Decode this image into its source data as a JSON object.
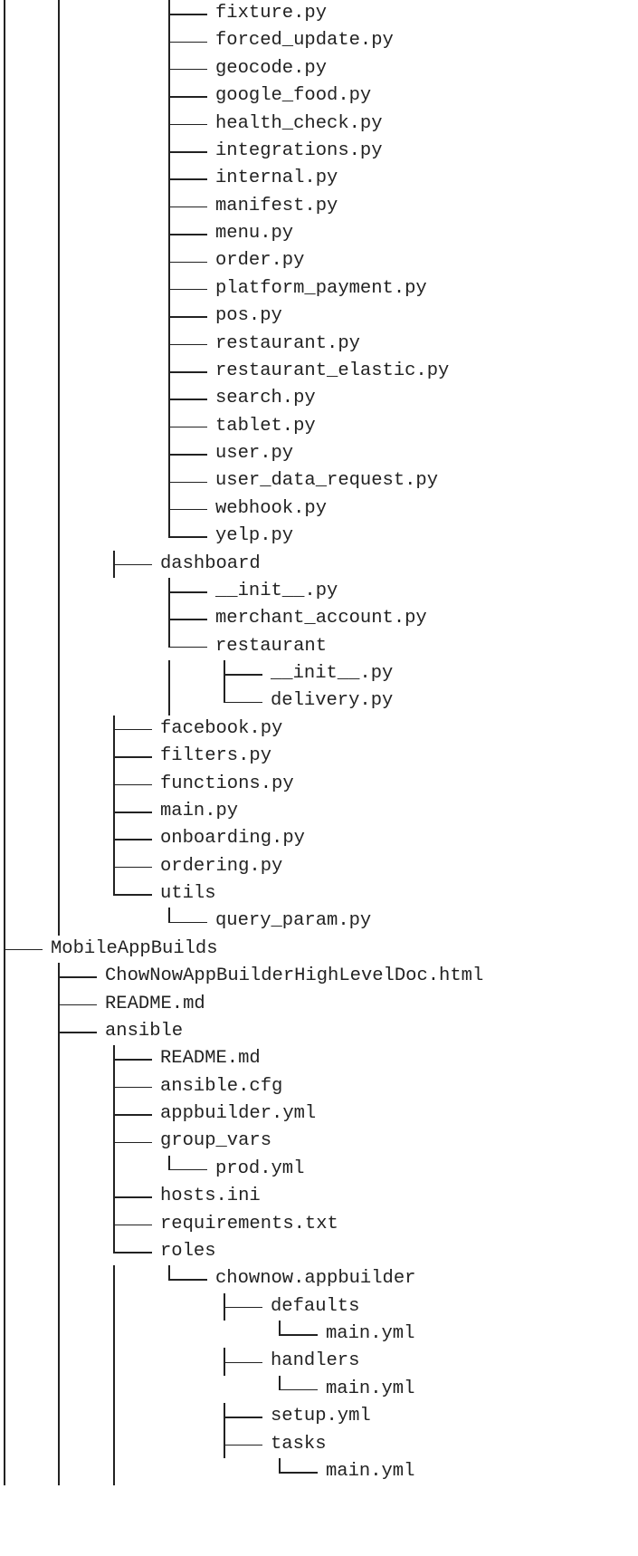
{
  "tree": [
    {
      "name": "fixture.py",
      "depth": 3,
      "ancestors_continue": [
        true,
        true,
        false,
        true
      ],
      "last": false
    },
    {
      "name": "forced_update.py",
      "depth": 3,
      "ancestors_continue": [
        true,
        true,
        false,
        true
      ],
      "last": false
    },
    {
      "name": "geocode.py",
      "depth": 3,
      "ancestors_continue": [
        true,
        true,
        false,
        true
      ],
      "last": false
    },
    {
      "name": "google_food.py",
      "depth": 3,
      "ancestors_continue": [
        true,
        true,
        false,
        true
      ],
      "last": false
    },
    {
      "name": "health_check.py",
      "depth": 3,
      "ancestors_continue": [
        true,
        true,
        false,
        true
      ],
      "last": false
    },
    {
      "name": "integrations.py",
      "depth": 3,
      "ancestors_continue": [
        true,
        true,
        false,
        true
      ],
      "last": false
    },
    {
      "name": "internal.py",
      "depth": 3,
      "ancestors_continue": [
        true,
        true,
        false,
        true
      ],
      "last": false
    },
    {
      "name": "manifest.py",
      "depth": 3,
      "ancestors_continue": [
        true,
        true,
        false,
        true
      ],
      "last": false
    },
    {
      "name": "menu.py",
      "depth": 3,
      "ancestors_continue": [
        true,
        true,
        false,
        true
      ],
      "last": false
    },
    {
      "name": "order.py",
      "depth": 3,
      "ancestors_continue": [
        true,
        true,
        false,
        true
      ],
      "last": false
    },
    {
      "name": "platform_payment.py",
      "depth": 3,
      "ancestors_continue": [
        true,
        true,
        false,
        true
      ],
      "last": false
    },
    {
      "name": "pos.py",
      "depth": 3,
      "ancestors_continue": [
        true,
        true,
        false,
        true
      ],
      "last": false
    },
    {
      "name": "restaurant.py",
      "depth": 3,
      "ancestors_continue": [
        true,
        true,
        false,
        true
      ],
      "last": false
    },
    {
      "name": "restaurant_elastic.py",
      "depth": 3,
      "ancestors_continue": [
        true,
        true,
        false,
        true
      ],
      "last": false
    },
    {
      "name": "search.py",
      "depth": 3,
      "ancestors_continue": [
        true,
        true,
        false,
        true
      ],
      "last": false
    },
    {
      "name": "tablet.py",
      "depth": 3,
      "ancestors_continue": [
        true,
        true,
        false,
        true
      ],
      "last": false
    },
    {
      "name": "user.py",
      "depth": 3,
      "ancestors_continue": [
        true,
        true,
        false,
        true
      ],
      "last": false
    },
    {
      "name": "user_data_request.py",
      "depth": 3,
      "ancestors_continue": [
        true,
        true,
        false,
        true
      ],
      "last": false
    },
    {
      "name": "webhook.py",
      "depth": 3,
      "ancestors_continue": [
        true,
        true,
        false,
        true
      ],
      "last": false
    },
    {
      "name": "yelp.py",
      "depth": 3,
      "ancestors_continue": [
        true,
        true,
        false,
        true
      ],
      "last": true
    },
    {
      "name": "dashboard",
      "depth": 2,
      "ancestors_continue": [
        true,
        true,
        false
      ],
      "last": false
    },
    {
      "name": "__init__.py",
      "depth": 3,
      "ancestors_continue": [
        true,
        true,
        false,
        true
      ],
      "last": false
    },
    {
      "name": "merchant_account.py",
      "depth": 3,
      "ancestors_continue": [
        true,
        true,
        false,
        true
      ],
      "last": false
    },
    {
      "name": "restaurant",
      "depth": 3,
      "ancestors_continue": [
        true,
        true,
        false,
        true
      ],
      "last": true
    },
    {
      "name": "__init__.py",
      "depth": 4,
      "ancestors_continue": [
        true,
        true,
        false,
        true,
        false
      ],
      "last": false
    },
    {
      "name": "delivery.py",
      "depth": 4,
      "ancestors_continue": [
        true,
        true,
        false,
        true,
        false
      ],
      "last": true
    },
    {
      "name": "facebook.py",
      "depth": 2,
      "ancestors_continue": [
        true,
        true,
        false
      ],
      "last": false
    },
    {
      "name": "filters.py",
      "depth": 2,
      "ancestors_continue": [
        true,
        true,
        false
      ],
      "last": false
    },
    {
      "name": "functions.py",
      "depth": 2,
      "ancestors_continue": [
        true,
        true,
        false
      ],
      "last": false
    },
    {
      "name": "main.py",
      "depth": 2,
      "ancestors_continue": [
        true,
        true,
        false
      ],
      "last": false
    },
    {
      "name": "onboarding.py",
      "depth": 2,
      "ancestors_continue": [
        true,
        true,
        false
      ],
      "last": false
    },
    {
      "name": "ordering.py",
      "depth": 2,
      "ancestors_continue": [
        true,
        true,
        false
      ],
      "last": false
    },
    {
      "name": "utils",
      "depth": 2,
      "ancestors_continue": [
        true,
        true,
        false
      ],
      "last": true
    },
    {
      "name": "query_param.py",
      "depth": 3,
      "ancestors_continue": [
        true,
        true,
        false,
        false
      ],
      "last": true
    },
    {
      "name": "MobileAppBuilds",
      "depth": 0,
      "ancestors_continue": [
        true
      ],
      "last": false
    },
    {
      "name": "ChowNowAppBuilderHighLevelDoc.html",
      "depth": 1,
      "ancestors_continue": [
        true,
        true
      ],
      "last": false
    },
    {
      "name": "README.md",
      "depth": 1,
      "ancestors_continue": [
        true,
        true
      ],
      "last": false
    },
    {
      "name": "ansible",
      "depth": 1,
      "ancestors_continue": [
        true,
        true
      ],
      "last": false
    },
    {
      "name": "README.md",
      "depth": 2,
      "ancestors_continue": [
        true,
        true,
        true
      ],
      "last": false
    },
    {
      "name": "ansible.cfg",
      "depth": 2,
      "ancestors_continue": [
        true,
        true,
        true
      ],
      "last": false
    },
    {
      "name": "appbuilder.yml",
      "depth": 2,
      "ancestors_continue": [
        true,
        true,
        true
      ],
      "last": false
    },
    {
      "name": "group_vars",
      "depth": 2,
      "ancestors_continue": [
        true,
        true,
        true
      ],
      "last": false
    },
    {
      "name": "prod.yml",
      "depth": 3,
      "ancestors_continue": [
        true,
        true,
        true,
        true
      ],
      "last": true
    },
    {
      "name": "hosts.ini",
      "depth": 2,
      "ancestors_continue": [
        true,
        true,
        true
      ],
      "last": false
    },
    {
      "name": "requirements.txt",
      "depth": 2,
      "ancestors_continue": [
        true,
        true,
        true
      ],
      "last": false
    },
    {
      "name": "roles",
      "depth": 2,
      "ancestors_continue": [
        true,
        true,
        true
      ],
      "last": true
    },
    {
      "name": "chownow.appbuilder",
      "depth": 3,
      "ancestors_continue": [
        true,
        true,
        true,
        false
      ],
      "last": true
    },
    {
      "name": "defaults",
      "depth": 4,
      "ancestors_continue": [
        true,
        true,
        true,
        false,
        false
      ],
      "last": false
    },
    {
      "name": "main.yml",
      "depth": 5,
      "ancestors_continue": [
        true,
        true,
        true,
        false,
        false,
        true
      ],
      "last": true
    },
    {
      "name": "handlers",
      "depth": 4,
      "ancestors_continue": [
        true,
        true,
        true,
        false,
        false
      ],
      "last": false
    },
    {
      "name": "main.yml",
      "depth": 5,
      "ancestors_continue": [
        true,
        true,
        true,
        false,
        false,
        true
      ],
      "last": true
    },
    {
      "name": "setup.yml",
      "depth": 4,
      "ancestors_continue": [
        true,
        true,
        true,
        false,
        false
      ],
      "last": false
    },
    {
      "name": "tasks",
      "depth": 4,
      "ancestors_continue": [
        true,
        true,
        true,
        false,
        false
      ],
      "last": false
    },
    {
      "name": "main.yml",
      "depth": 5,
      "ancestors_continue": [
        true,
        true,
        true,
        false,
        false,
        true
      ],
      "last": true
    }
  ]
}
